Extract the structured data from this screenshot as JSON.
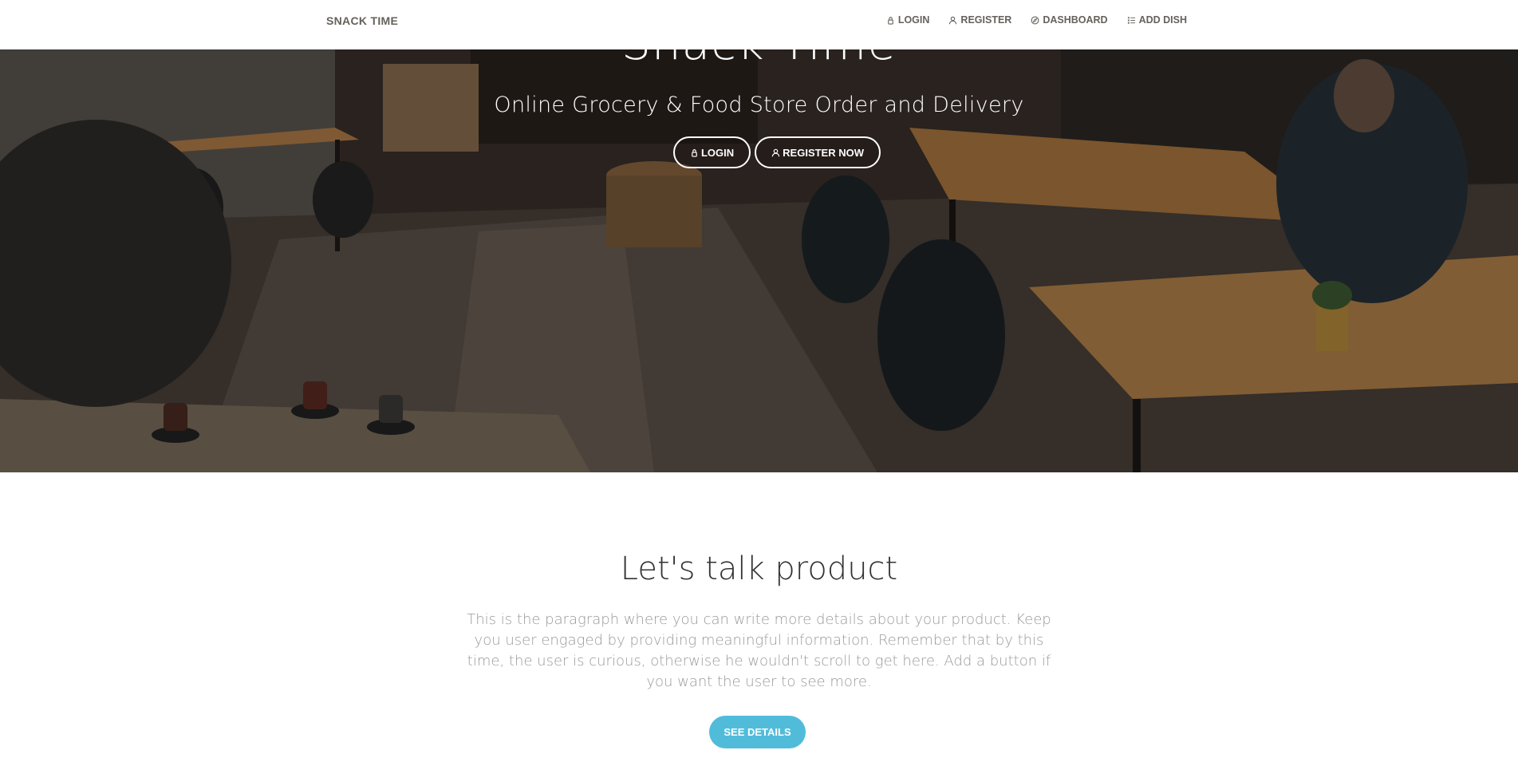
{
  "navbar": {
    "brand": "SNACK TIME",
    "links": [
      {
        "label": "LOGIN",
        "icon": "lock-icon"
      },
      {
        "label": "REGISTER",
        "icon": "user-icon"
      },
      {
        "label": "DASHBOARD",
        "icon": "compass-icon"
      },
      {
        "label": "ADD DISH",
        "icon": "list-icon"
      }
    ]
  },
  "hero": {
    "title": "Snack Time",
    "subtitle": "Online Grocery & Food Store Order and Delivery",
    "buttons": [
      {
        "label": "LOGIN",
        "icon": "lock-icon"
      },
      {
        "label": "REGISTER NOW",
        "icon": "user-icon"
      }
    ]
  },
  "section": {
    "title": "Let's talk product",
    "description": "This is the paragraph where you can write more details about your product. Keep you user engaged by providing meaningful information. Remember that by this time, the user is curious, otherwise he wouldn't scroll to get here. Add a button if you want the user to see more.",
    "button_label": "SEE DETAILS"
  },
  "colors": {
    "nav_text": "#66615b",
    "info_button": "#51bcda",
    "section_title": "#333333",
    "section_text": "#9a9a9a"
  }
}
